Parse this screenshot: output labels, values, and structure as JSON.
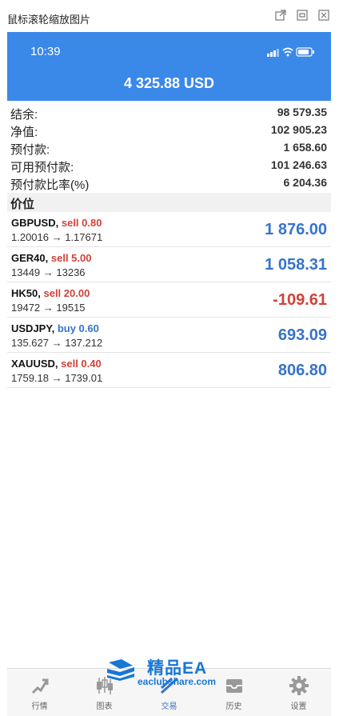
{
  "viewer": {
    "title": "鼠标滚轮缩放图片"
  },
  "status_bar": {
    "time": "10:39"
  },
  "account": {
    "balance": "4 325.88 USD"
  },
  "summary": [
    {
      "label": "结余:",
      "value": "98 579.35"
    },
    {
      "label": "净值:",
      "value": "102 905.23"
    },
    {
      "label": "预付款:",
      "value": "1 658.60"
    },
    {
      "label": "可用预付款:",
      "value": "101 246.63"
    },
    {
      "label": "预付款比率(%)",
      "value": "6 204.36"
    }
  ],
  "section": {
    "label": "价位"
  },
  "positions": [
    {
      "symbol": "GBPUSD,",
      "direction": "sell 0.80",
      "dir_color": "#d0423a",
      "prices": "1.20016 → 1.17671",
      "profit": "1 876.00",
      "profit_color": "#3674c9"
    },
    {
      "symbol": "GER40,",
      "direction": "sell 5.00",
      "dir_color": "#d0423a",
      "prices": "13449 → 13236",
      "profit": "1 058.31",
      "profit_color": "#3674c9"
    },
    {
      "symbol": "HK50,",
      "direction": "sell 20.00",
      "dir_color": "#d0423a",
      "prices": "19472 → 19515",
      "profit": "-109.61",
      "profit_color": "#d0423a"
    },
    {
      "symbol": "USDJPY,",
      "direction": "buy 0.60",
      "dir_color": "#3674c9",
      "prices": "135.627 → 137.212",
      "profit": "693.09",
      "profit_color": "#3674c9"
    },
    {
      "symbol": "XAUUSD,",
      "direction": "sell 0.40",
      "dir_color": "#d0423a",
      "prices": "1759.18 → 1739.01",
      "profit": "806.80",
      "profit_color": "#3674c9"
    }
  ],
  "tabs": [
    {
      "label": "行情",
      "icon": "quotes-icon"
    },
    {
      "label": "图表",
      "icon": "chart-icon"
    },
    {
      "label": "交易",
      "icon": "trade-icon",
      "active": true
    },
    {
      "label": "历史",
      "icon": "history-icon"
    },
    {
      "label": "设置",
      "icon": "settings-icon"
    }
  ],
  "watermark": {
    "title": "精品EA",
    "subtitle": "eaclubshare.com"
  },
  "colors": {
    "header_bg": "#3a88e8",
    "profit_positive": "#3674c9",
    "profit_negative": "#d0423a"
  }
}
